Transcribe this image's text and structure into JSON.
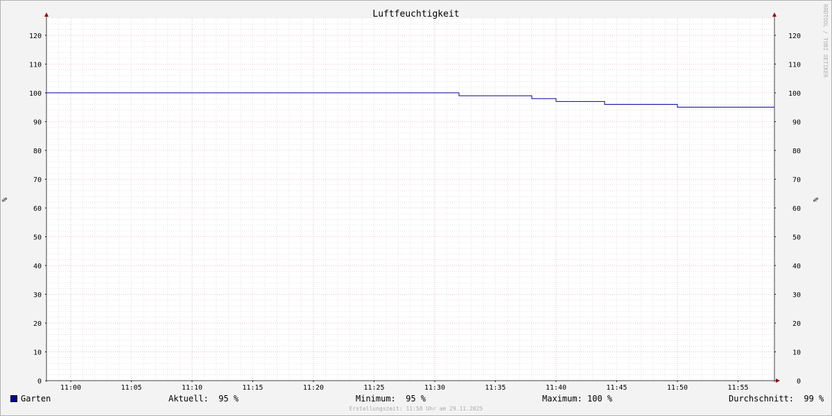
{
  "chart_data": {
    "type": "line",
    "title": "Luftfeuchtigkeit",
    "ylabel_left": "%",
    "ylabel_right": "%",
    "ylim": [
      0,
      126
    ],
    "yticks": [
      0,
      10,
      20,
      30,
      40,
      50,
      60,
      70,
      80,
      90,
      100,
      110,
      120
    ],
    "xlim": [
      "10:58",
      "11:58"
    ],
    "xticks": [
      "11:00",
      "11:05",
      "11:10",
      "11:15",
      "11:20",
      "11:25",
      "11:30",
      "11:35",
      "11:40",
      "11:45",
      "11:50",
      "11:55"
    ],
    "grid": true,
    "series": [
      {
        "name": "Garten",
        "color": "#000099",
        "points": [
          {
            "t": "10:58",
            "v": 100
          },
          {
            "t": "11:32",
            "v": 99
          },
          {
            "t": "11:38",
            "v": 98
          },
          {
            "t": "11:40",
            "v": 97
          },
          {
            "t": "11:44",
            "v": 96
          },
          {
            "t": "11:50",
            "v": 95
          },
          {
            "t": "11:58",
            "v": 95
          }
        ]
      }
    ],
    "watermark": "RRDTOOL / TOBI OETIKER"
  },
  "legend": {
    "series_name": "Garten",
    "aktuell": "Aktuell:  95 %",
    "minimum": "Minimum:  95 %",
    "maximum": "Maximum: 100 %",
    "durchschnitt": "Durchschnitt:  99 %"
  },
  "footer": "Erstellungszeit: 11:58 Uhr am 29.11.2025",
  "colors": {
    "background": "#f3f3f3",
    "canvas": "#ffffff",
    "grid_minor": "#d0d0d0",
    "grid_major": "#e8a0b0",
    "axis": "#000000",
    "arrow": "#990000",
    "series": "#000099"
  }
}
